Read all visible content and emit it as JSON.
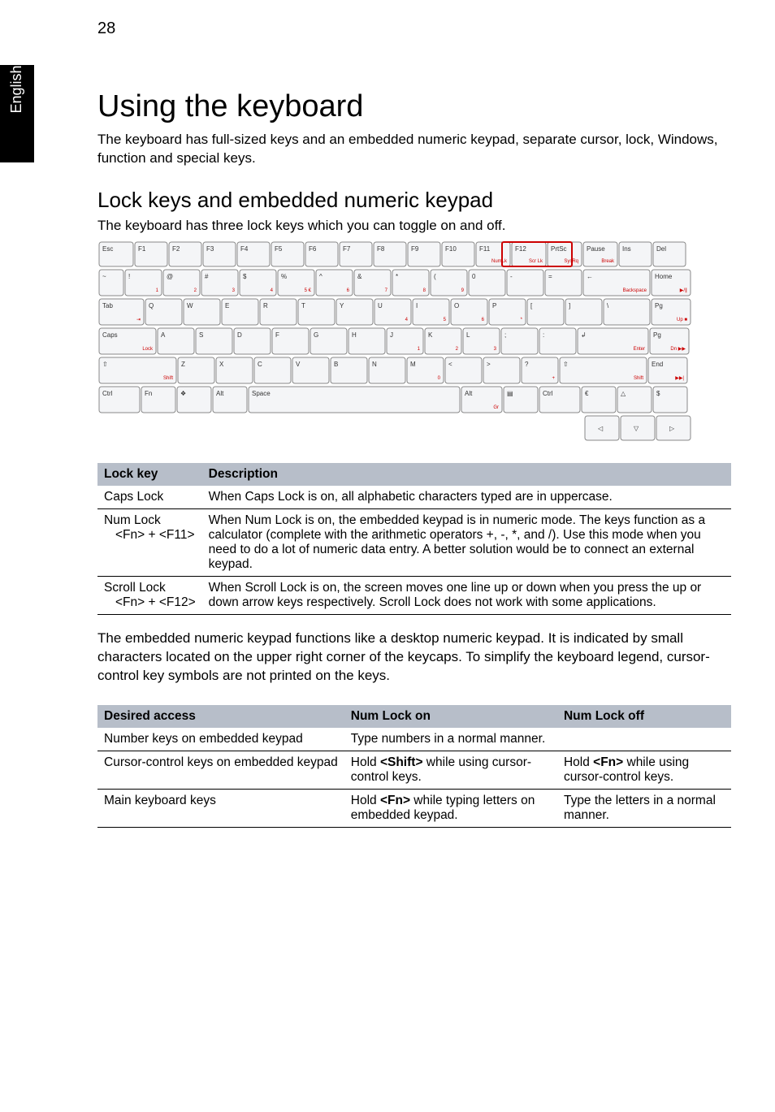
{
  "page_number": "28",
  "language_tab": "English",
  "heading": "Using the keyboard",
  "intro": "The keyboard has full-sized keys and an embedded numeric keypad, separate cursor, lock, Windows, function and special keys.",
  "section_heading": "Lock keys and embedded numeric keypad",
  "section_sub": "The keyboard has three lock keys which you can toggle on and off.",
  "keyboard_diagram": {
    "redbox_keys": [
      "F11 NumLk",
      "F12 Scr Lk"
    ],
    "rows": {
      "function_row": [
        "Esc",
        "F1",
        "F2",
        "F3",
        "F4",
        "F5",
        "F6",
        "F7",
        "F8",
        "F9",
        "F10",
        "F11 NumLk",
        "F12 Scr Lk",
        "PrtSc SysRq",
        "Pause Break",
        "Ins",
        "Del"
      ],
      "number_row": [
        "~",
        "! 1",
        "@ 2",
        "# 3",
        "$ 4",
        "% 5 €",
        "^ 6",
        "& 7",
        "* 8",
        "( 9",
        "0",
        "-",
        "=",
        "← Backspace",
        "Home ▶/∥"
      ],
      "qwerty_row": [
        "Tab ⇥",
        "Q",
        "W",
        "E",
        "R",
        "T",
        "Y",
        "U 4",
        "I 5",
        "O 6",
        "P *",
        "[",
        "]",
        "\\",
        "Pg Up ■"
      ],
      "home_row": [
        "Caps Lock",
        "A",
        "S",
        "D",
        "F",
        "G",
        "H",
        "J 1",
        "K 2",
        "L 3",
        ";",
        ":",
        "↲ Enter",
        "Pg Dn ▶▶"
      ],
      "shift_row": [
        "⇧ Shift",
        "Z",
        "X",
        "C",
        "V",
        "B",
        "N",
        "M 0",
        "<",
        ">",
        "? +",
        "⇧ Shift",
        "End ▶▶|"
      ],
      "space_row": [
        "Ctrl",
        "Fn",
        "❖",
        "Alt",
        "Space",
        "Alt Gr",
        "▤",
        "Ctrl",
        "€",
        "△",
        "$"
      ],
      "arrow_row": [
        "◁",
        "▽",
        "▷"
      ]
    }
  },
  "lock_table": {
    "headers": [
      "Lock key",
      "Description"
    ],
    "rows": [
      {
        "k": "Caps Lock",
        "s": "",
        "d": "When Caps Lock is on, all alphabetic characters typed are in uppercase."
      },
      {
        "k": "Num Lock",
        "s": "<Fn> + <F11>",
        "d": "When Num Lock is on, the embedded keypad is in numeric mode. The keys function as a calculator (complete with the arithmetic operators +, -, *, and /). Use this mode when you need to do a lot of numeric data entry. A better solution would be to connect an external keypad."
      },
      {
        "k": "Scroll Lock",
        "s": "<Fn> + <F12>",
        "d": "When Scroll Lock is on, the screen moves one line up or down when you press the up or down arrow keys respectively. Scroll Lock does not work with some applications."
      }
    ]
  },
  "mid_para": "The embedded numeric keypad functions like a desktop numeric keypad. It is indicated by small characters located on the upper right corner of the keycaps. To simplify the keyboard legend, cursor-control key symbols are not printed on the keys.",
  "access_table": {
    "headers": [
      "Desired access",
      "Num Lock on",
      "Num Lock off"
    ],
    "rows": [
      {
        "a": "Number keys on embedded keypad",
        "on": "Type numbers in a normal manner.",
        "off": ""
      },
      {
        "a": "Cursor-control keys on embedded keypad",
        "on_pre": "Hold ",
        "on_bold": "<Shift>",
        "on_post": " while using cursor-control keys.",
        "off_pre": "Hold ",
        "off_bold": "<Fn>",
        "off_post": " while using cursor-control keys."
      },
      {
        "a": "Main keyboard keys",
        "on_pre": "Hold ",
        "on_bold": "<Fn>",
        "on_post": " while typing letters on embedded keypad.",
        "off_pre": "",
        "off_bold": "",
        "off_post": "Type the letters in a normal manner."
      }
    ]
  }
}
